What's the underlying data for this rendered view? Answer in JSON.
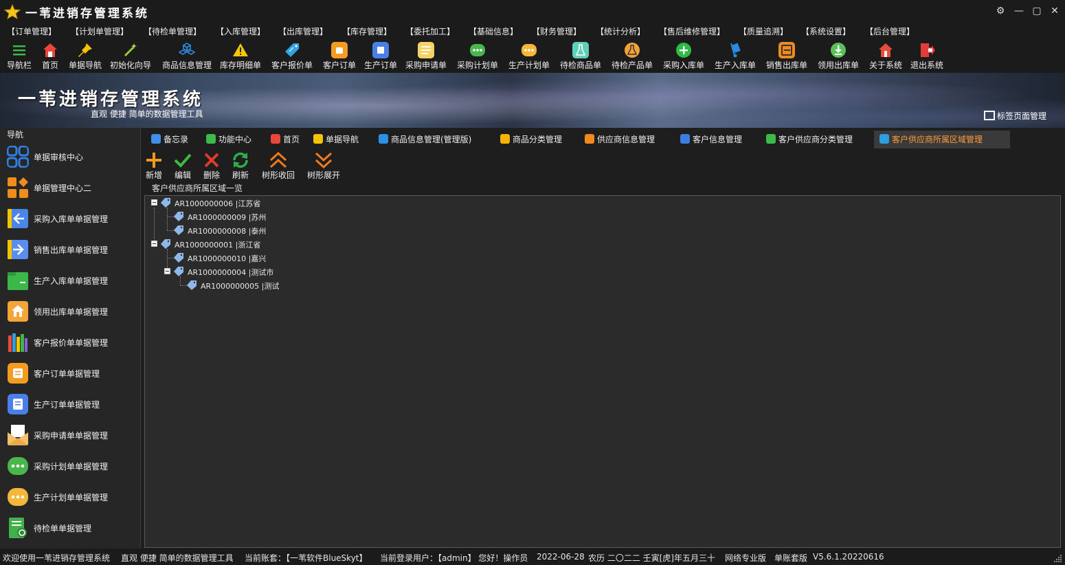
{
  "app": {
    "title": "一苇进销存管理系统",
    "window_controls": {
      "settings": "⚙",
      "minimize": "—",
      "restore": "▢",
      "close": "✕"
    }
  },
  "menu": [
    "【订单管理】",
    "【计划单管理】",
    "【待检单管理】",
    "【入库管理】",
    "【出库管理】",
    "【库存管理】",
    "【委托加工】",
    "【基础信息】",
    "【财务管理】",
    "【统计分析】",
    "【售后维修管理】",
    "【质量追溯】",
    "【系统设置】",
    "【后台管理】"
  ],
  "toolbar": [
    {
      "label": "导航栏",
      "icon": "menu-lines-icon",
      "color": "#3cba4a"
    },
    {
      "label": "首页",
      "icon": "home-icon",
      "color": "#e8473a"
    },
    {
      "label": "单据导航",
      "icon": "pin-icon",
      "color": "#f5c400"
    },
    {
      "label": "初始化向导",
      "icon": "magic-wand-icon",
      "color": "#9acd32"
    },
    {
      "label": "商品信息管理",
      "icon": "cubes-icon",
      "color": "#2f8fe6"
    },
    {
      "label": "库存明细单",
      "icon": "warning-icon",
      "color": "#f7c600"
    },
    {
      "label": "客户报价单",
      "icon": "price-tag-icon",
      "color": "#2ea5e0"
    },
    {
      "label": "客户订单",
      "icon": "order-doc-icon",
      "color": "#f39c21"
    },
    {
      "label": "生产订单",
      "icon": "production-doc-icon",
      "color": "#4a7ee8"
    },
    {
      "label": "采购申请单",
      "icon": "request-doc-icon",
      "color": "#f6d365"
    },
    {
      "label": "采购计划单",
      "icon": "chat-dots-icon",
      "color": "#49b64c"
    },
    {
      "label": "生产计划单",
      "icon": "chat-dots-icon",
      "color": "#f4b73a"
    },
    {
      "label": "待检商品单",
      "icon": "flask-icon",
      "color": "#5fd0b8"
    },
    {
      "label": "待检产品单",
      "icon": "beaker-icon",
      "color": "#f2a23c"
    },
    {
      "label": "采购入库单",
      "icon": "plus-circle-icon",
      "color": "#2dbb45"
    },
    {
      "label": "生产入库单",
      "icon": "hand-truck-icon",
      "color": "#2b8be0"
    },
    {
      "label": "销售出库单",
      "icon": "box-out-icon",
      "color": "#f08a1c"
    },
    {
      "label": "领用出库单",
      "icon": "download-icon",
      "color": "#5cc05a"
    },
    {
      "label": "关于系统",
      "icon": "house-info-icon",
      "color": "#e84c3d"
    },
    {
      "label": "退出系统",
      "icon": "exit-icon",
      "color": "#e43b3b"
    }
  ],
  "banner": {
    "title": "一苇进销存管理系统",
    "subtitle": "直观 便捷 简单的数据管理工具",
    "tab_manage": "标签页面管理"
  },
  "sidebar": {
    "title": "导航",
    "items": [
      {
        "label": "单据审核中心",
        "icon": "grid-icon",
        "color": "#2d7fe0"
      },
      {
        "label": "单据管理中心二",
        "icon": "grid-mixed-icon",
        "color": "#f08c1c"
      },
      {
        "label": "采购入库单单据管理",
        "icon": "arrow-left-doc-icon",
        "color": "#4a86e8"
      },
      {
        "label": "销售出库单单据管理",
        "icon": "arrow-right-doc-icon",
        "color": "#5a8ef0"
      },
      {
        "label": "生产入库单单据管理",
        "icon": "folder-green-icon",
        "color": "#3cb84a"
      },
      {
        "label": "领用出库单单据管理",
        "icon": "house-doc-icon",
        "color": "#f4a53a"
      },
      {
        "label": "客户报价单单据管理",
        "icon": "books-icon",
        "color": "#3b9bd8"
      },
      {
        "label": "客户订单单据管理",
        "icon": "order-doc-icon",
        "color": "#f39c21"
      },
      {
        "label": "生产订单单据管理",
        "icon": "production-doc-icon",
        "color": "#4a7ee8"
      },
      {
        "label": "采购申请单单据管理",
        "icon": "envelope-doc-icon",
        "color": "#f4c16a"
      },
      {
        "label": "采购计划单单据管理",
        "icon": "chat-dots-icon",
        "color": "#49b64c"
      },
      {
        "label": "生产计划单单据管理",
        "icon": "chat-dots-icon",
        "color": "#f4b73a"
      },
      {
        "label": "待检单单据管理",
        "icon": "inspect-doc-icon",
        "color": "#43b14b"
      }
    ]
  },
  "tabs": [
    {
      "label": "备忘录",
      "icon": "memo-icon",
      "color": "#3f8ee8"
    },
    {
      "label": "功能中心",
      "icon": "function-grid-icon",
      "color": "#3cba4a"
    },
    {
      "label": "首页",
      "icon": "home-icon",
      "color": "#e8473a"
    },
    {
      "label": "单据导航",
      "icon": "pin-icon",
      "color": "#f5c400"
    },
    {
      "label": "商品信息管理(管理版)",
      "icon": "cubes-icon",
      "color": "#2f8fe6"
    },
    {
      "label": "商品分类管理",
      "icon": "tag-icon",
      "color": "#f5b400"
    },
    {
      "label": "供应商信息管理",
      "icon": "supplier-icon",
      "color": "#f08a1c"
    },
    {
      "label": "客户信息管理",
      "icon": "user-icon",
      "color": "#3b7ee0"
    },
    {
      "label": "客户供应商分类管理",
      "icon": "list-icon",
      "color": "#3cba4a"
    },
    {
      "label": "客户供应商所属区域管理",
      "icon": "region-icon",
      "color": "#2e9ee0",
      "active": true
    }
  ],
  "actions": [
    {
      "label": "新增",
      "icon": "plus-icon",
      "color": "#f39a1e"
    },
    {
      "label": "编辑",
      "icon": "check-icon",
      "color": "#3cba3c"
    },
    {
      "label": "删除",
      "icon": "close-icon",
      "color": "#e23a2a"
    },
    {
      "label": "刷新",
      "icon": "refresh-icon",
      "color": "#2eae4a"
    },
    {
      "label": "树形收回",
      "icon": "chevron-up-icon",
      "color": "#f07a1e"
    },
    {
      "label": "树形展开",
      "icon": "chevron-down-icon",
      "color": "#f07a1e"
    }
  ],
  "region_panel": {
    "title": "客户供应商所属区域一览",
    "tree": [
      {
        "code": "AR1000000006",
        "name": "江苏省",
        "text": "AR1000000006 |江苏省",
        "expanded": true,
        "children": [
          {
            "code": "AR1000000009",
            "name": "苏州",
            "text": "AR1000000009 |苏州"
          },
          {
            "code": "AR1000000008",
            "name": "泰州",
            "text": "AR1000000008 |泰州"
          }
        ]
      },
      {
        "code": "AR1000000001",
        "name": "浙江省",
        "text": "AR1000000001 |浙江省",
        "expanded": true,
        "children": [
          {
            "code": "AR1000000010",
            "name": "嘉兴",
            "text": "AR1000000010 |嘉兴"
          },
          {
            "code": "AR1000000004",
            "name": "测试市",
            "text": "AR1000000004 |测试市",
            "expanded": true,
            "children": [
              {
                "code": "AR1000000005",
                "name": "测试",
                "text": "AR1000000005 |测试"
              }
            ]
          }
        ]
      }
    ]
  },
  "statusbar": {
    "welcome": "欢迎使用一苇进销存管理系统",
    "slogan": "直观 便捷 简单的数据管理工具",
    "account": "当前账套：【一苇软件BlueSkyt】",
    "user": "当前登录用户：【admin】 您好！操作员",
    "date": "2022-06-28",
    "lunar": "农历 二〇二二 壬寅[虎]年五月三十",
    "edition": "网络专业版",
    "mode": "单账套版",
    "version": "V5.6.1.20220616"
  }
}
